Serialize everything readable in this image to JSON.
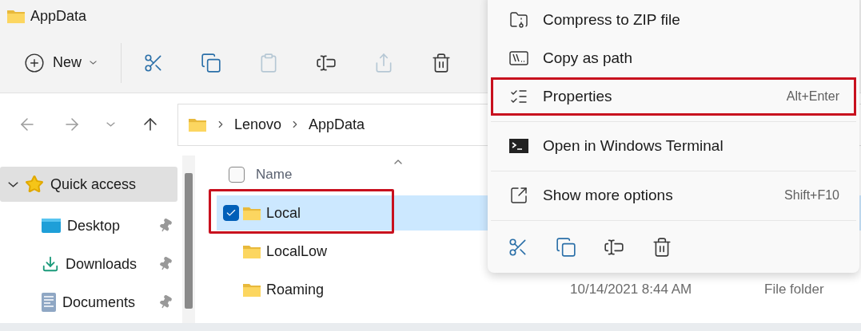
{
  "window": {
    "title": "AppData"
  },
  "toolbar": {
    "new_label": "New",
    "actions": [
      {
        "kind": "cut",
        "disabled": false
      },
      {
        "kind": "copy",
        "disabled": false
      },
      {
        "kind": "paste",
        "disabled": true
      },
      {
        "kind": "rename",
        "disabled": false
      },
      {
        "kind": "share",
        "disabled": true
      },
      {
        "kind": "delete",
        "disabled": false
      }
    ]
  },
  "navigation": [
    {
      "kind": "back",
      "disabled": true
    },
    {
      "kind": "forward",
      "disabled": true
    },
    {
      "kind": "recent",
      "disabled": true
    },
    {
      "kind": "up",
      "disabled": false
    }
  ],
  "address_bar": {
    "path": [
      "Lenovo",
      "AppData"
    ]
  },
  "sidebar": {
    "items": [
      {
        "kind": "star",
        "label": "Quick access",
        "expanded": true,
        "selected": true,
        "children": [
          {
            "kind": "desktop",
            "label": "Desktop",
            "pinned": true,
            "selected": false
          },
          {
            "kind": "downloads",
            "label": "Downloads",
            "pinned": true,
            "selected": false
          },
          {
            "kind": "documents",
            "label": "Documents",
            "pinned": true,
            "selected": false
          }
        ]
      }
    ]
  },
  "file_list": {
    "columns": [
      {
        "label": "Name"
      }
    ],
    "select_all_checked": false,
    "rows": [
      {
        "name": "Local",
        "selected": true,
        "checked": true,
        "highlighted": true
      },
      {
        "name": "LocalLow",
        "selected": false,
        "checked": false,
        "highlighted": false
      },
      {
        "name": "Roaming",
        "selected": false,
        "checked": false,
        "highlighted": false,
        "column_2": "10/14/2021 8:44 AM",
        "column_3": "File folder"
      }
    ]
  },
  "context_menu": {
    "items": [
      {
        "kind": "zip",
        "label": "Compress to ZIP file",
        "highlighted": false
      },
      {
        "kind": "path",
        "label": "Copy as path",
        "highlighted": false
      },
      {
        "kind": "properties",
        "label": "Properties",
        "shortcut": "Alt+Enter",
        "highlighted": true
      },
      {
        "kind": "separator"
      },
      {
        "kind": "terminal",
        "label": "Open in Windows Terminal",
        "highlighted": false
      },
      {
        "kind": "separator"
      },
      {
        "kind": "more",
        "label": "Show more options",
        "shortcut": "Shift+F10",
        "highlighted": false
      },
      {
        "kind": "separator"
      }
    ],
    "quick_actions": [
      {
        "kind": "cut"
      },
      {
        "kind": "copy"
      },
      {
        "kind": "rename"
      },
      {
        "kind": "delete"
      }
    ]
  }
}
